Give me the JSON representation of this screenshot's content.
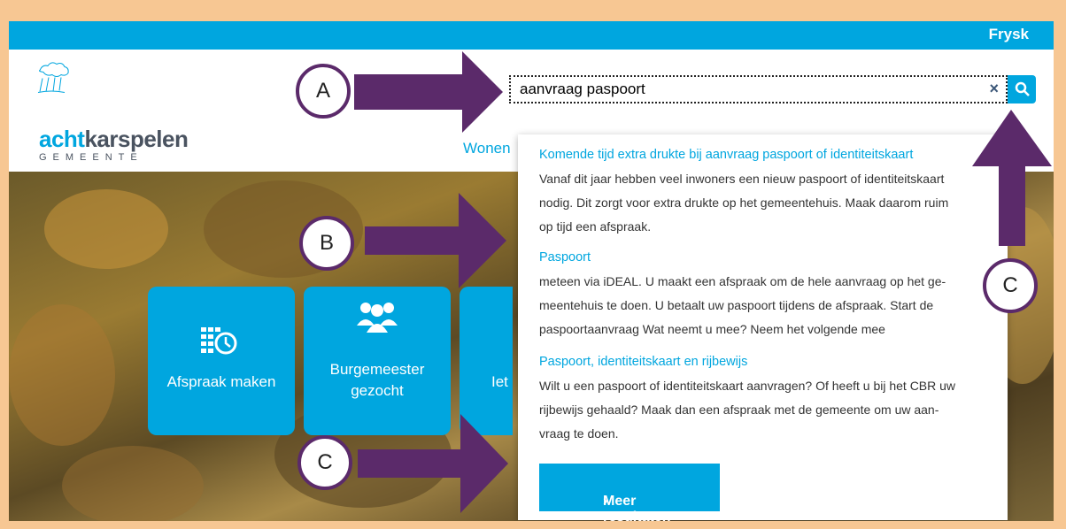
{
  "topbar": {
    "language": "Frysk"
  },
  "logo": {
    "name_accent": "acht",
    "name_rest": "karspelen",
    "subtitle": "GEMEENTE"
  },
  "nav": {
    "wonen": "Wonen"
  },
  "search": {
    "value": "aanvraag paspoort",
    "clear_glyph": "×"
  },
  "tiles": [
    {
      "label": "Afspraak maken"
    },
    {
      "label_line1": "Burgemeester",
      "label_line2": "gezocht"
    },
    {
      "label": "Iet"
    }
  ],
  "results": [
    {
      "title": "Komende tijd extra drukte bij aanvraag paspoort of identiteitskaart",
      "line1": "Vanaf dit jaar hebben veel inwoners een nieuw paspoort of identiteitskaart",
      "line2": "nodig. Dit zorgt voor extra drukte op het gemeentehuis. Maak daarom ruim",
      "line3": "op tijd een afspraak."
    },
    {
      "title": "Paspoort",
      "line1": "meteen via iDEAL.     U maakt een afspraak om de hele aanvraag op het ge-",
      "line2": "meentehuis te doen. U betaalt uw paspoort tijdens de afspraak.   Start de",
      "line3": "paspoortaanvraag Wat neemt u mee?  Neem het volgende mee"
    },
    {
      "title": "Paspoort, identiteitskaart en rijbewijs",
      "line1": "Wilt u een paspoort of identiteitskaart aanvragen? Of heeft u bij het CBR uw",
      "line2": "rijbewijs gehaald? Maak dan een afspraak met de gemeente om uw aan-",
      "line3": "vraag te doen."
    }
  ],
  "more_results": {
    "label": "Meer resultaten",
    "chevron": "›"
  },
  "annotations": {
    "a": "A",
    "b": "B",
    "c1": "C",
    "c2": "C"
  },
  "colors": {
    "brand_blue": "#00a6df",
    "arrow_purple": "#5b2a6a",
    "frame_orange": "#f7c793"
  }
}
